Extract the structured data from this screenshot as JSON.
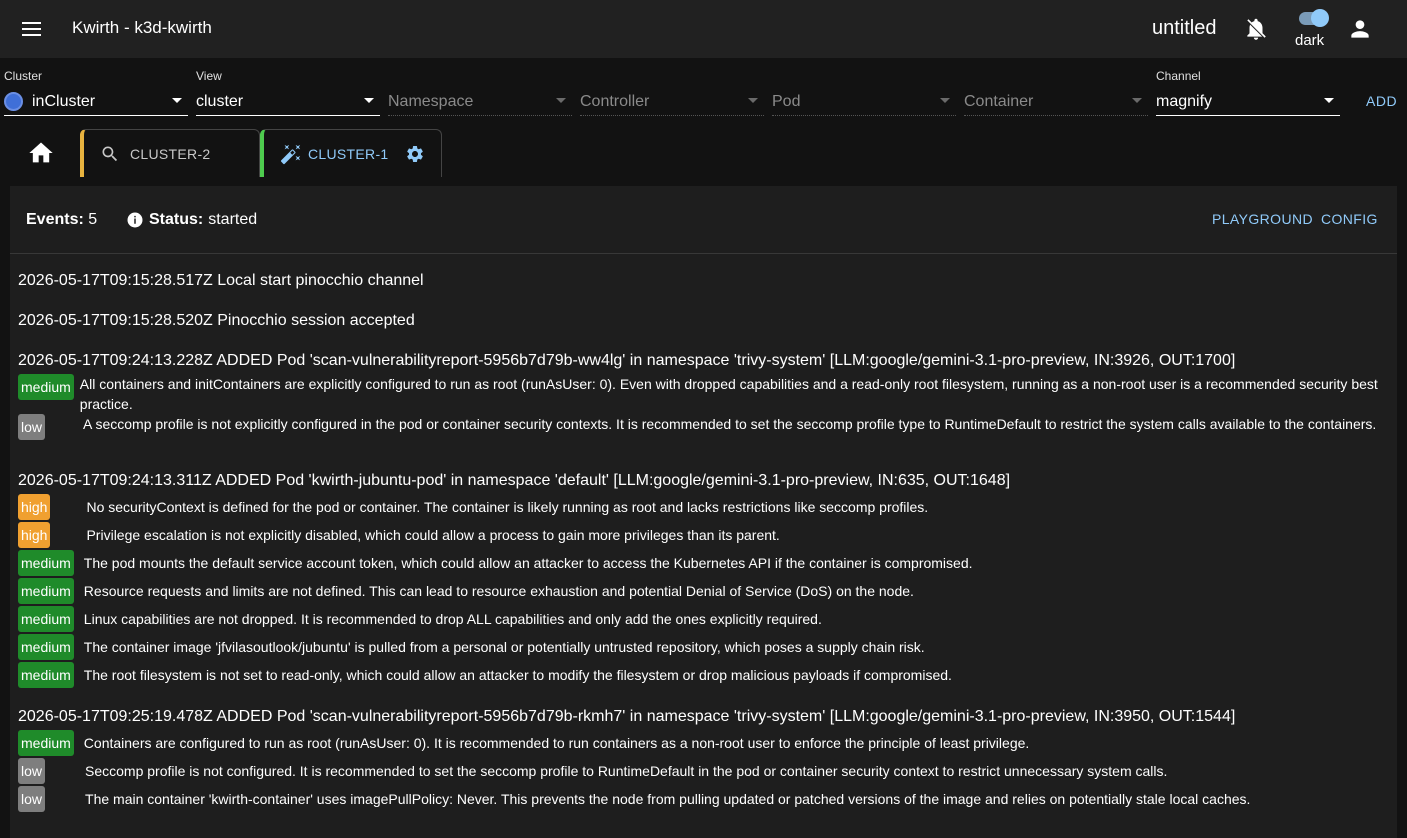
{
  "appbar": {
    "title": "Kwirth - k3d-kwirth",
    "board_name": "untitled",
    "theme_label": "dark",
    "icons": {
      "menu": "menu-icon",
      "bell": "bell-off-icon",
      "user": "account-icon"
    }
  },
  "selectors": {
    "cluster": {
      "label": "Cluster",
      "value": "inCluster"
    },
    "view": {
      "label": "View",
      "value": "cluster"
    },
    "namespace": {
      "placeholder": "Namespace"
    },
    "controller": {
      "placeholder": "Controller"
    },
    "pod": {
      "placeholder": "Pod"
    },
    "container": {
      "placeholder": "Container"
    },
    "channel": {
      "label": "Channel",
      "value": "magnify"
    },
    "add_label": "ADD"
  },
  "tabs": [
    {
      "label": "CLUSTER-2",
      "icon": "search-icon",
      "color": "#e8b33f"
    },
    {
      "label": "CLUSTER-1",
      "icon": "magic-wand-icon",
      "color": "#4ecb4e"
    }
  ],
  "panel": {
    "events_label": "Events:",
    "events_count": "5",
    "status_label": "Status:",
    "status_value": "started",
    "playground_label": "PLAYGROUND",
    "config_label": "CONFIG"
  },
  "log": {
    "l1": "2026-05-17T09:15:28.517Z Local start pinocchio channel",
    "l2": "2026-05-17T09:15:28.520Z Pinocchio session accepted",
    "l3": "2026-05-17T09:24:13.228Z ADDED Pod 'scan-vulnerabilityreport-5956b7d79b-ww4lg' in namespace 'trivy-system' [LLM:google/gemini-3.1-pro-preview, IN:3926, OUT:1700]",
    "l3f": [
      {
        "level": "medium",
        "text": "All containers and initContainers are explicitly configured to run as root (runAsUser: 0). Even with dropped capabilities and a read-only root filesystem, running as a non-root user is a recommended security best practice."
      },
      {
        "level": "low",
        "text": "A seccomp profile is not explicitly configured in the pod or container security contexts. It is recommended to set the seccomp profile type to RuntimeDefault to restrict the system calls available to the containers."
      }
    ],
    "l4": "2026-05-17T09:24:13.311Z ADDED Pod 'kwirth-jubuntu-pod' in namespace 'default' [LLM:google/gemini-3.1-pro-preview, IN:635, OUT:1648]",
    "l4f": [
      {
        "level": "high",
        "text": "No securityContext is defined for the pod or container. The container is likely running as root and lacks restrictions like seccomp profiles."
      },
      {
        "level": "high",
        "text": "Privilege escalation is not explicitly disabled, which could allow a process to gain more privileges than its parent."
      },
      {
        "level": "medium",
        "text": "The pod mounts the default service account token, which could allow an attacker to access the Kubernetes API if the container is compromised."
      },
      {
        "level": "medium",
        "text": "Resource requests and limits are not defined. This can lead to resource exhaustion and potential Denial of Service (DoS) on the node."
      },
      {
        "level": "medium",
        "text": "Linux capabilities are not dropped. It is recommended to drop ALL capabilities and only add the ones explicitly required."
      },
      {
        "level": "medium",
        "text": "The container image 'jfvilasoutlook/jubuntu' is pulled from a personal or potentially untrusted repository, which poses a supply chain risk."
      },
      {
        "level": "medium",
        "text": "The root filesystem is not set to read-only, which could allow an attacker to modify the filesystem or drop malicious payloads if compromised."
      }
    ],
    "l5": "2026-05-17T09:25:19.478Z ADDED Pod 'scan-vulnerabilityreport-5956b7d79b-rkmh7' in namespace 'trivy-system' [LLM:google/gemini-3.1-pro-preview, IN:3950, OUT:1544]",
    "l5f": [
      {
        "level": "medium",
        "text": "Containers are configured to run as root (runAsUser: 0). It is recommended to run containers as a non-root user to enforce the principle of least privilege."
      },
      {
        "level": "low",
        "text": "Seccomp profile is not configured. It is recommended to set the seccomp profile to RuntimeDefault in the pod or container security context to restrict unnecessary system calls."
      },
      {
        "level": "low",
        "text": "The main container 'kwirth-container' uses imagePullPolicy: Never. This prevents the node from pulling updated or patched versions of the image and relies on potentially stale local caches."
      }
    ]
  },
  "colors": {
    "medium": "#1f8b2a",
    "low": "#7e7e7e",
    "high": "#f0a030",
    "accent": "#90caf9"
  }
}
